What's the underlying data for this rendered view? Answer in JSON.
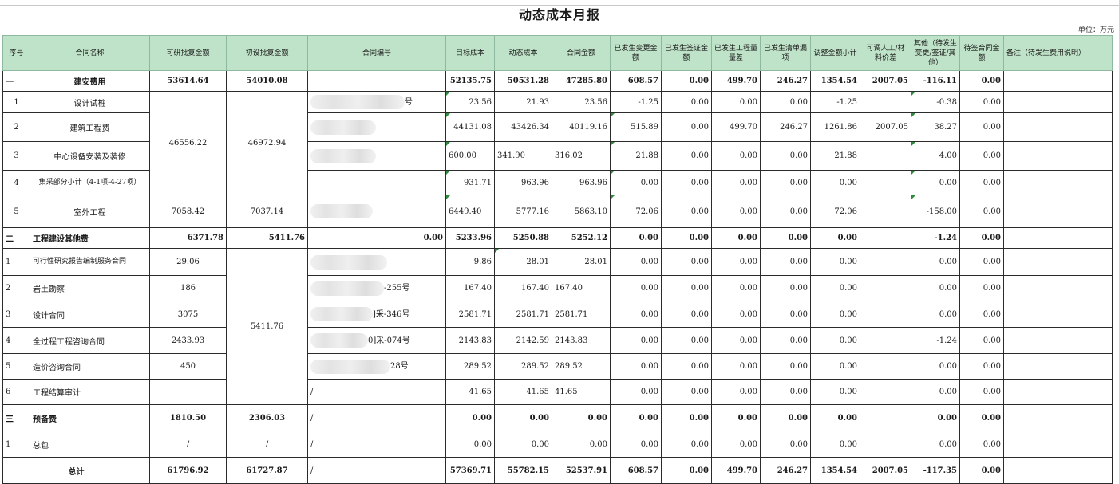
{
  "title": "动态成本月报",
  "unit": "单位：万元",
  "headers": [
    "序号",
    "合同名称",
    "可研批复金额",
    "初设批复金额",
    "合同编号",
    "目标成本",
    "动态成本",
    "合同金额",
    "已发生变更金额",
    "已发生签证金额",
    "已发生工程量量差",
    "已发生清单漏项",
    "调整金额小计",
    "可调人工/材料价差",
    "其他（待发生变更/签证/其他）",
    "待签合同金额",
    "备注（待发生费用说明）"
  ],
  "rows": {
    "r0": {
      "no": "一",
      "name": "建安费用",
      "ky": "53614.64",
      "cs": "54010.08",
      "code": "",
      "c5": "52135.75",
      "c6": "50531.28",
      "c7": "47285.80",
      "c8": "608.57",
      "c9": "0.00",
      "c10": "499.70",
      "c11": "246.27",
      "c12": "1354.54",
      "c13": "2007.05",
      "c14": "-116.11",
      "c15": "0.00"
    },
    "r1": {
      "no": "1",
      "name": "设计试桩",
      "code": "号",
      "c5": "23.56",
      "c6": "21.93",
      "c7": "23.56",
      "c8": "-1.25",
      "c9": "0.00",
      "c10": "0.00",
      "c11": "0.00",
      "c12": "-1.25",
      "c13": "",
      "c14": "-0.38",
      "c15": "0.00"
    },
    "r2": {
      "no": "2",
      "name": "建筑工程费",
      "code": "",
      "c5": "44131.08",
      "c6": "43426.34",
      "c7": "40119.16",
      "c8": "515.89",
      "c9": "0.00",
      "c10": "499.70",
      "c11": "246.27",
      "c12": "1261.86",
      "c13": "2007.05",
      "c14": "38.27",
      "c15": "0.00"
    },
    "r3": {
      "no": "3",
      "name": "中心设备安装及装修",
      "code": "",
      "c5": "600.00",
      "c6": "341.90",
      "c7": "316.02",
      "c8": "21.88",
      "c9": "0.00",
      "c10": "0.00",
      "c11": "0.00",
      "c12": "21.88",
      "c13": "",
      "c14": "4.00",
      "c15": "0.00"
    },
    "r4": {
      "no": "4",
      "name": "集采部分小计（4-1项-4-27项）",
      "code": "",
      "c5": "931.71",
      "c6": "963.96",
      "c7": "963.96",
      "c8": "0.00",
      "c9": "0.00",
      "c10": "0.00",
      "c11": "0.00",
      "c12": "0.00",
      "c13": "",
      "c14": "0.00",
      "c15": "0.00"
    },
    "r5": {
      "no": "5",
      "name": "室外工程",
      "ky": "7058.42",
      "cs": "7037.14",
      "code": "",
      "c5": "6449.40",
      "c6": "5777.16",
      "c7": "5863.10",
      "c8": "72.06",
      "c9": "0.00",
      "c10": "0.00",
      "c11": "0.00",
      "c12": "72.06",
      "c13": "",
      "c14": "-158.00",
      "c15": "0.00"
    },
    "r6": {
      "no": "二",
      "name": "工程建设其他费",
      "ky": "6371.78",
      "cs": "5411.76",
      "code": "0.00",
      "c5": "5233.96",
      "c6": "5250.88",
      "c7": "5252.12",
      "c8": "0.00",
      "c9": "0.00",
      "c10": "0.00",
      "c11": "0.00",
      "c12": "0.00",
      "c13": "",
      "c14": "-1.24",
      "c15": "0.00"
    },
    "r7": {
      "no": "1",
      "name": "可行性研究报告编制服务合同",
      "ky": "29.06",
      "code": "",
      "c5": "9.86",
      "c6": "28.01",
      "c7": "28.01",
      "c8": "0.00",
      "c9": "0.00",
      "c10": "0.00",
      "c11": "0.00",
      "c12": "0.00",
      "c13": "",
      "c14": "0.00",
      "c15": "0.00"
    },
    "r8": {
      "no": "2",
      "name": "岩土勘察",
      "ky": "186",
      "code": "-255号",
      "c5": "167.40",
      "c6": "167.40",
      "c7": "167.40",
      "c8": "0.00",
      "c9": "0.00",
      "c10": "0.00",
      "c11": "0.00",
      "c12": "0.00",
      "c13": "",
      "c14": "0.00",
      "c15": "0.00"
    },
    "r9": {
      "no": "3",
      "name": "设计合同",
      "ky": "3075",
      "code": "]采-346号",
      "c5": "2581.71",
      "c6": "2581.71",
      "c7": "2581.71",
      "c8": "0.00",
      "c9": "0.00",
      "c10": "0.00",
      "c11": "0.00",
      "c12": "0.00",
      "c13": "",
      "c14": "0.00",
      "c15": "0.00"
    },
    "r10": {
      "no": "4",
      "name": "全过程工程咨询合同",
      "ky": "2433.93",
      "code": "0]采-074号",
      "c5": "2143.83",
      "c6": "2142.59",
      "c7": "2143.83",
      "c8": "0.00",
      "c9": "0.00",
      "c10": "0.00",
      "c11": "0.00",
      "c12": "0.00",
      "c13": "",
      "c14": "-1.24",
      "c15": "0.00"
    },
    "r11": {
      "no": "5",
      "name": "造价咨询合同",
      "ky": "450",
      "code": "28号",
      "c5": "289.52",
      "c6": "289.52",
      "c7": "289.52",
      "c8": "0.00",
      "c9": "0.00",
      "c10": "0.00",
      "c11": "0.00",
      "c12": "0.00",
      "c13": "",
      "c14": "0.00",
      "c15": "0.00"
    },
    "r12": {
      "no": "6",
      "name": "工程结算审计",
      "ky": "",
      "code": "/",
      "c5": "41.65",
      "c6": "41.65",
      "c7": "41.65",
      "c8": "0.00",
      "c9": "0.00",
      "c10": "0.00",
      "c11": "0.00",
      "c12": "0.00",
      "c13": "",
      "c14": "0.00",
      "c15": "0.00"
    },
    "r13": {
      "no": "三",
      "name": "预备费",
      "ky": "1810.50",
      "cs": "2306.03",
      "code": "/",
      "c5": "0.00",
      "c6": "0.00",
      "c7": "0.00",
      "c8": "0.00",
      "c9": "0.00",
      "c10": "0.00",
      "c11": "0.00",
      "c12": "0.00",
      "c13": "",
      "c14": "0.00",
      "c15": "0.00"
    },
    "r14": {
      "no": "1",
      "name": "总包",
      "ky": "/",
      "cs": "/",
      "code": "/",
      "c5": "0.00",
      "c6": "0.00",
      "c7": "0.00",
      "c8": "0.00",
      "c9": "0.00",
      "c10": "0.00",
      "c11": "0.00",
      "c12": "0.00",
      "c13": "",
      "c14": "0.00",
      "c15": "0.00"
    },
    "r15": {
      "name": "总计",
      "ky": "61796.92",
      "cs": "61727.87",
      "code": "/",
      "c5": "57369.71",
      "c6": "55782.15",
      "c7": "52537.91",
      "c8": "608.57",
      "c9": "0.00",
      "c10": "499.70",
      "c11": "246.27",
      "c12": "1354.54",
      "c13": "2007.05",
      "c14": "-117.35",
      "c15": "0.00"
    }
  },
  "merged": {
    "ky_1_4": "46556.22",
    "cs_1_4": "46972.94",
    "cs_7_12": "5411.76"
  },
  "colors": {
    "header_bg": "#bfe3c8",
    "marker": "#2e8b3d"
  }
}
